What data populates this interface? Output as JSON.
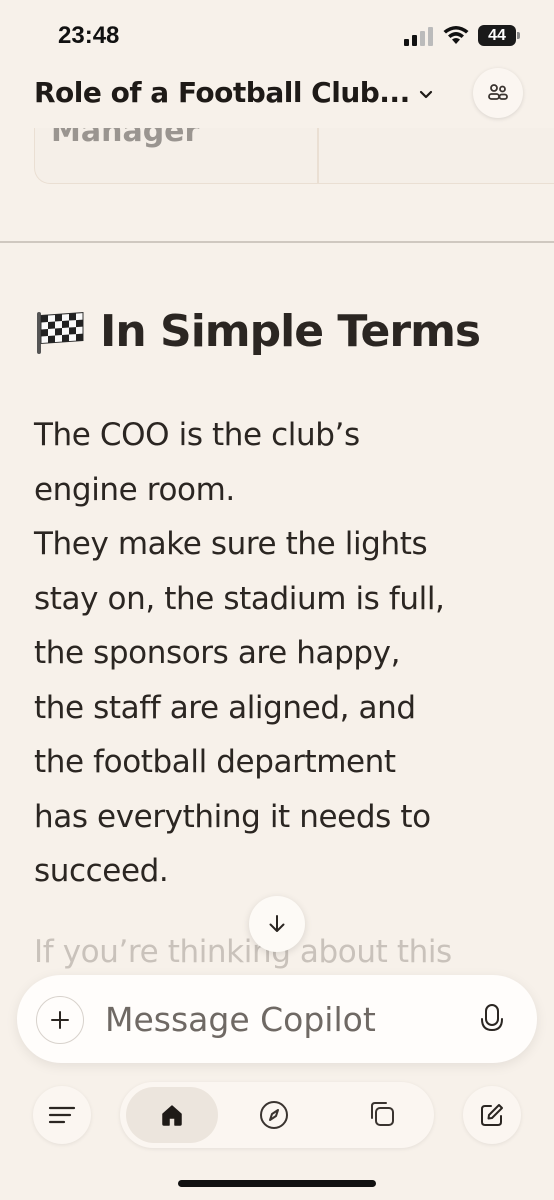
{
  "status_bar": {
    "time": "23:48",
    "battery": "44"
  },
  "header": {
    "title": "Role of a Football Club..."
  },
  "partial_card": {
    "text": "Manager"
  },
  "section": {
    "emoji": "checkered-flag-icon",
    "heading": "In Simple Terms",
    "paragraph_lines": [
      "The COO is the club’s",
      "engine room.",
      "They make sure the lights",
      "stay on, the stadium is full,",
      "the sponsors are happy,",
      "the staff are aligned, and",
      "the football department",
      "has everything it needs to",
      "succeed."
    ],
    "faded_text": "If you’re thinking about this"
  },
  "composer": {
    "placeholder": "Message Copilot"
  },
  "colors": {
    "background": "#f7f1ea",
    "text": "#2b2622",
    "surface": "#fffdfb"
  }
}
